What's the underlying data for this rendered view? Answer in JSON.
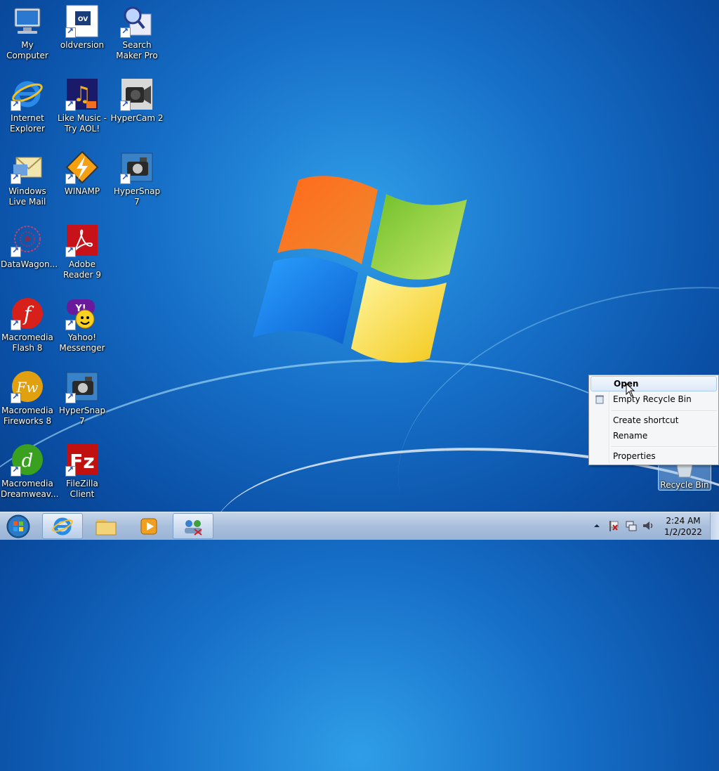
{
  "desktop": {
    "icons": [
      {
        "label": "My Computer",
        "icon": "computer-icon"
      },
      {
        "label": "oldversion",
        "icon": "oldversion-icon"
      },
      {
        "label": "Search Maker Pro",
        "icon": "search-maker-icon"
      },
      {
        "label": "Internet Explorer",
        "icon": "internet-explorer-icon"
      },
      {
        "label": "Like Music - Try AOL!",
        "icon": "music-notes-icon"
      },
      {
        "label": "HyperCam 2",
        "icon": "camcorder-icon"
      },
      {
        "label": "Windows Live Mail",
        "icon": "mail-icon"
      },
      {
        "label": "WINAMP",
        "icon": "winamp-icon"
      },
      {
        "label": "HyperSnap 7",
        "icon": "camera-icon"
      },
      {
        "label": "DataWagon...",
        "icon": "datawagon-icon"
      },
      {
        "label": "Adobe Reader 9",
        "icon": "adobe-reader-icon"
      },
      {
        "label": "Macromedia Flash 8",
        "icon": "flash-icon"
      },
      {
        "label": "Yahoo! Messenger",
        "icon": "yahoo-messenger-icon"
      },
      {
        "label": "Macromedia Fireworks 8",
        "icon": "fireworks-icon"
      },
      {
        "label": "HyperSnap 7",
        "icon": "camera-icon"
      },
      {
        "label": "Macromedia Dreamweav...",
        "icon": "dreamweaver-icon"
      },
      {
        "label": "FileZilla Client",
        "icon": "filezilla-icon"
      },
      {
        "label": "Recycle Bin",
        "icon": "recycle-bin-icon"
      }
    ]
  },
  "context_menu": {
    "items": [
      {
        "label": "Open",
        "highlighted": true
      },
      {
        "label": "Empty Recycle Bin",
        "icon": "recycle-bin-small-icon"
      },
      {
        "label": "Create shortcut"
      },
      {
        "label": "Rename"
      },
      {
        "label": "Properties"
      }
    ]
  },
  "taskbar": {
    "start_icon": "windows-start-orb-icon",
    "buttons": [
      {
        "icon": "internet-explorer-icon",
        "state": "active"
      },
      {
        "icon": "folder-icon",
        "state": "pinned"
      },
      {
        "icon": "media-player-icon",
        "state": "pinned"
      },
      {
        "icon": "network-app-icon",
        "state": "active"
      }
    ],
    "tray": {
      "icons": [
        "show-hidden-icons-arrow",
        "action-center-flag-icon",
        "network-icon",
        "volume-icon"
      ],
      "time": "2:24 AM",
      "date": "1/2/2022"
    }
  },
  "colors": {
    "desktop_blue": "#1770c8",
    "taskbar": "#a9bfdc",
    "menu_highlight": "#dde9f9"
  }
}
